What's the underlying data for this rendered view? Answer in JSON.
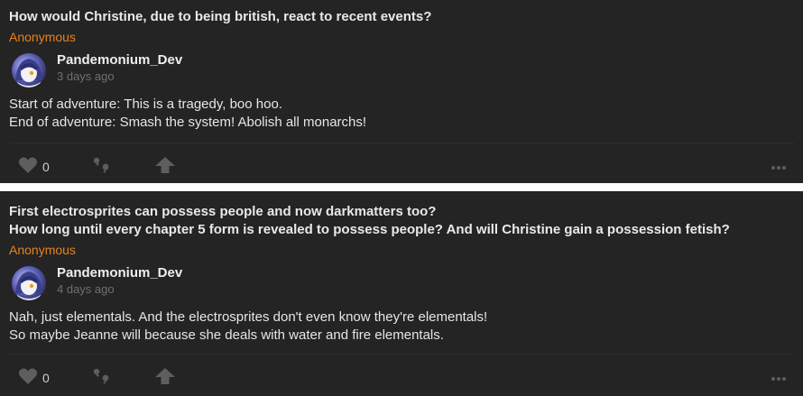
{
  "posts": [
    {
      "question": "How would Christine, due to being british, react to recent events?",
      "asker": "Anonymous",
      "author": "Pandemonium_Dev",
      "time": "3 days ago",
      "answer_lines": [
        "Start of adventure: This is a tragedy, boo hoo.",
        "End of adventure: Smash the system! Abolish all monarchs!"
      ],
      "likes": "0"
    },
    {
      "question_lines": [
        "First electrosprites can possess people and now darkmatters too?",
        "How long until every chapter 5 form is revealed to possess people? And will Christine gain a possession fetish?"
      ],
      "asker": "Anonymous",
      "author": "Pandemonium_Dev",
      "time": "4 days ago",
      "answer_lines": [
        "Nah, just elementals. And the electrosprites don't even know they're elementals!",
        "So maybe Jeanne will because she deals with water and fire elementals."
      ],
      "likes": "0"
    }
  ],
  "icons": {
    "like": "heart-icon",
    "quote": "quote-icon",
    "share": "share-arrow-icon",
    "more": "more-dots-icon",
    "avatar": "avatar-image"
  },
  "colors": {
    "card_bg": "#242424",
    "asker": "#e8821e",
    "icon": "#5e5e5e",
    "separator": "#ffffff"
  }
}
